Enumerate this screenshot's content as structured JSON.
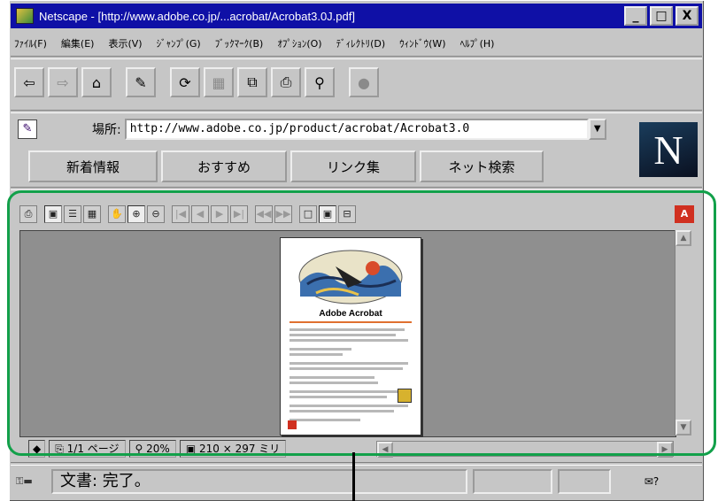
{
  "window": {
    "title": "Netscape - [http://www.adobe.co.jp/...acrobat/Acrobat3.0J.pdf]"
  },
  "title_buttons": {
    "minimize": "_",
    "maximize": "□",
    "close": "X"
  },
  "menu": [
    "ﾌｧｲﾙ(F)",
    "編集(E)",
    "表示(V)",
    "ｼﾞｬﾝﾌﾟ(G)",
    "ﾌﾞｯｸﾏｰｸ(B)",
    "ｵﾌﾟｼｮﾝ(O)",
    "ﾃﾞｨﾚｸﾄﾘ(D)",
    "ｳｨﾝﾄﾞｳ(W)",
    "ﾍﾙﾌﾟ(H)"
  ],
  "toolbar": {
    "back": "⇦",
    "forward": "⇨",
    "home": "⌂",
    "edit": "✎",
    "reload": "⟳",
    "images": "▦",
    "open": "⧉",
    "print": "⎙",
    "find": "⚲",
    "stop": "●"
  },
  "location": {
    "label": "場所:",
    "url": "http://www.adobe.co.jp/product/acrobat/Acrobat3.0",
    "dropdown": "▼"
  },
  "logo": "N",
  "directory_buttons": [
    "新着情報",
    "おすすめ",
    "リンク集",
    "ネット検索"
  ],
  "pdf_toolbar": {
    "print": "⎙",
    "page_only": "▣",
    "bookmarks": "☰",
    "thumbnails": "▦",
    "hand": "✋",
    "zoom_in": "⊕",
    "zoom_out": "⊖",
    "first": "|◀",
    "prev": "◀",
    "next": "▶",
    "last": "▶|",
    "go_back": "◀◀",
    "go_forward": "▶▶",
    "actual_size": "□",
    "fit_page": "▣",
    "fit_width": "⊟",
    "adobe": "A"
  },
  "pdf_page": {
    "title": "Adobe Acrobat"
  },
  "pdf_status": {
    "nav": "◆",
    "page": "1/1 ページ",
    "zoom": "20%",
    "size": "210 × 297 ミリ"
  },
  "scroll": {
    "up": "▲",
    "down": "▼",
    "left": "◀",
    "right": "▶"
  },
  "status": {
    "text": "文書: 完了。",
    "mail": "✉?"
  },
  "colors": {
    "titlebar": "#0f10a6",
    "highlight_frame": "#12a04a",
    "viewer_bg": "#8f8f8f"
  }
}
